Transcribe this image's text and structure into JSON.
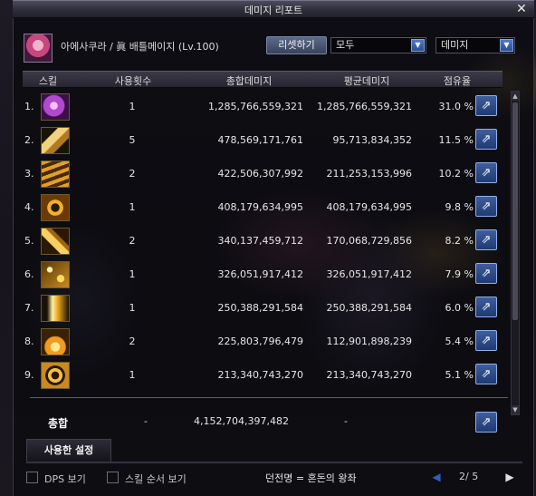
{
  "window": {
    "title": "데미지 리포트",
    "close_glyph": "✕"
  },
  "header": {
    "character_label": "아에사쿠라 / 眞 배틀메이지 (Lv.100)",
    "reset_button": "리셋하기",
    "filter_select_value": "모두",
    "type_select_value": "데미지"
  },
  "table": {
    "columns": [
      "스킬",
      "사용횟수",
      "총합데미지",
      "평균데미지",
      "점유율"
    ],
    "rows": [
      {
        "rank": "1.",
        "count": "1",
        "total": "1,285,766,559,321",
        "avg": "1,285,766,559,321",
        "share": "31.0 %",
        "icon": "purple-spark-skill-icon"
      },
      {
        "rank": "2.",
        "count": "5",
        "total": "478,569,171,761",
        "avg": "95,713,834,352",
        "share": "11.5 %",
        "icon": "club-swing-skill-icon"
      },
      {
        "rank": "3.",
        "count": "2",
        "total": "422,506,307,992",
        "avg": "211,253,153,996",
        "share": "10.2 %",
        "icon": "triple-strike-skill-icon"
      },
      {
        "rank": "4.",
        "count": "1",
        "total": "408,179,634,995",
        "avg": "408,179,634,995",
        "share": "9.8 %",
        "icon": "star-burst-skill-icon"
      },
      {
        "rank": "5.",
        "count": "2",
        "total": "340,137,459,712",
        "avg": "170,068,729,856",
        "share": "8.2 %",
        "icon": "golden-staff-skill-icon"
      },
      {
        "rank": "6.",
        "count": "1",
        "total": "326,051,917,412",
        "avg": "326,051,917,412",
        "share": "7.9 %",
        "icon": "sparkle-skill-icon"
      },
      {
        "rank": "7.",
        "count": "1",
        "total": "250,388,291,584",
        "avg": "250,388,291,584",
        "share": "6.0 %",
        "icon": "lightning-skill-icon"
      },
      {
        "rank": "8.",
        "count": "2",
        "total": "225,803,796,479",
        "avg": "112,901,898,239",
        "share": "5.4 %",
        "icon": "flame-orb-skill-icon"
      },
      {
        "rank": "9.",
        "count": "1",
        "total": "213,340,743,270",
        "avg": "213,340,743,270",
        "share": "5.1 %",
        "icon": "circle-strike-skill-icon"
      }
    ]
  },
  "total": {
    "label": "총합",
    "count": "-",
    "total": "4,152,704,397,482",
    "avg": "-"
  },
  "settings_tab": "사용한 설정",
  "footer": {
    "dps_label": "DPS 보기",
    "skill_order_label": "스킬 순서 보기",
    "dungeon": "던전명 = 혼돈의 왕좌",
    "page": "2/ 5"
  },
  "colors": {
    "accent_blue": "#2b4c92",
    "share_button": "#1f3a74",
    "panel_bg": "#0a0a0e"
  }
}
